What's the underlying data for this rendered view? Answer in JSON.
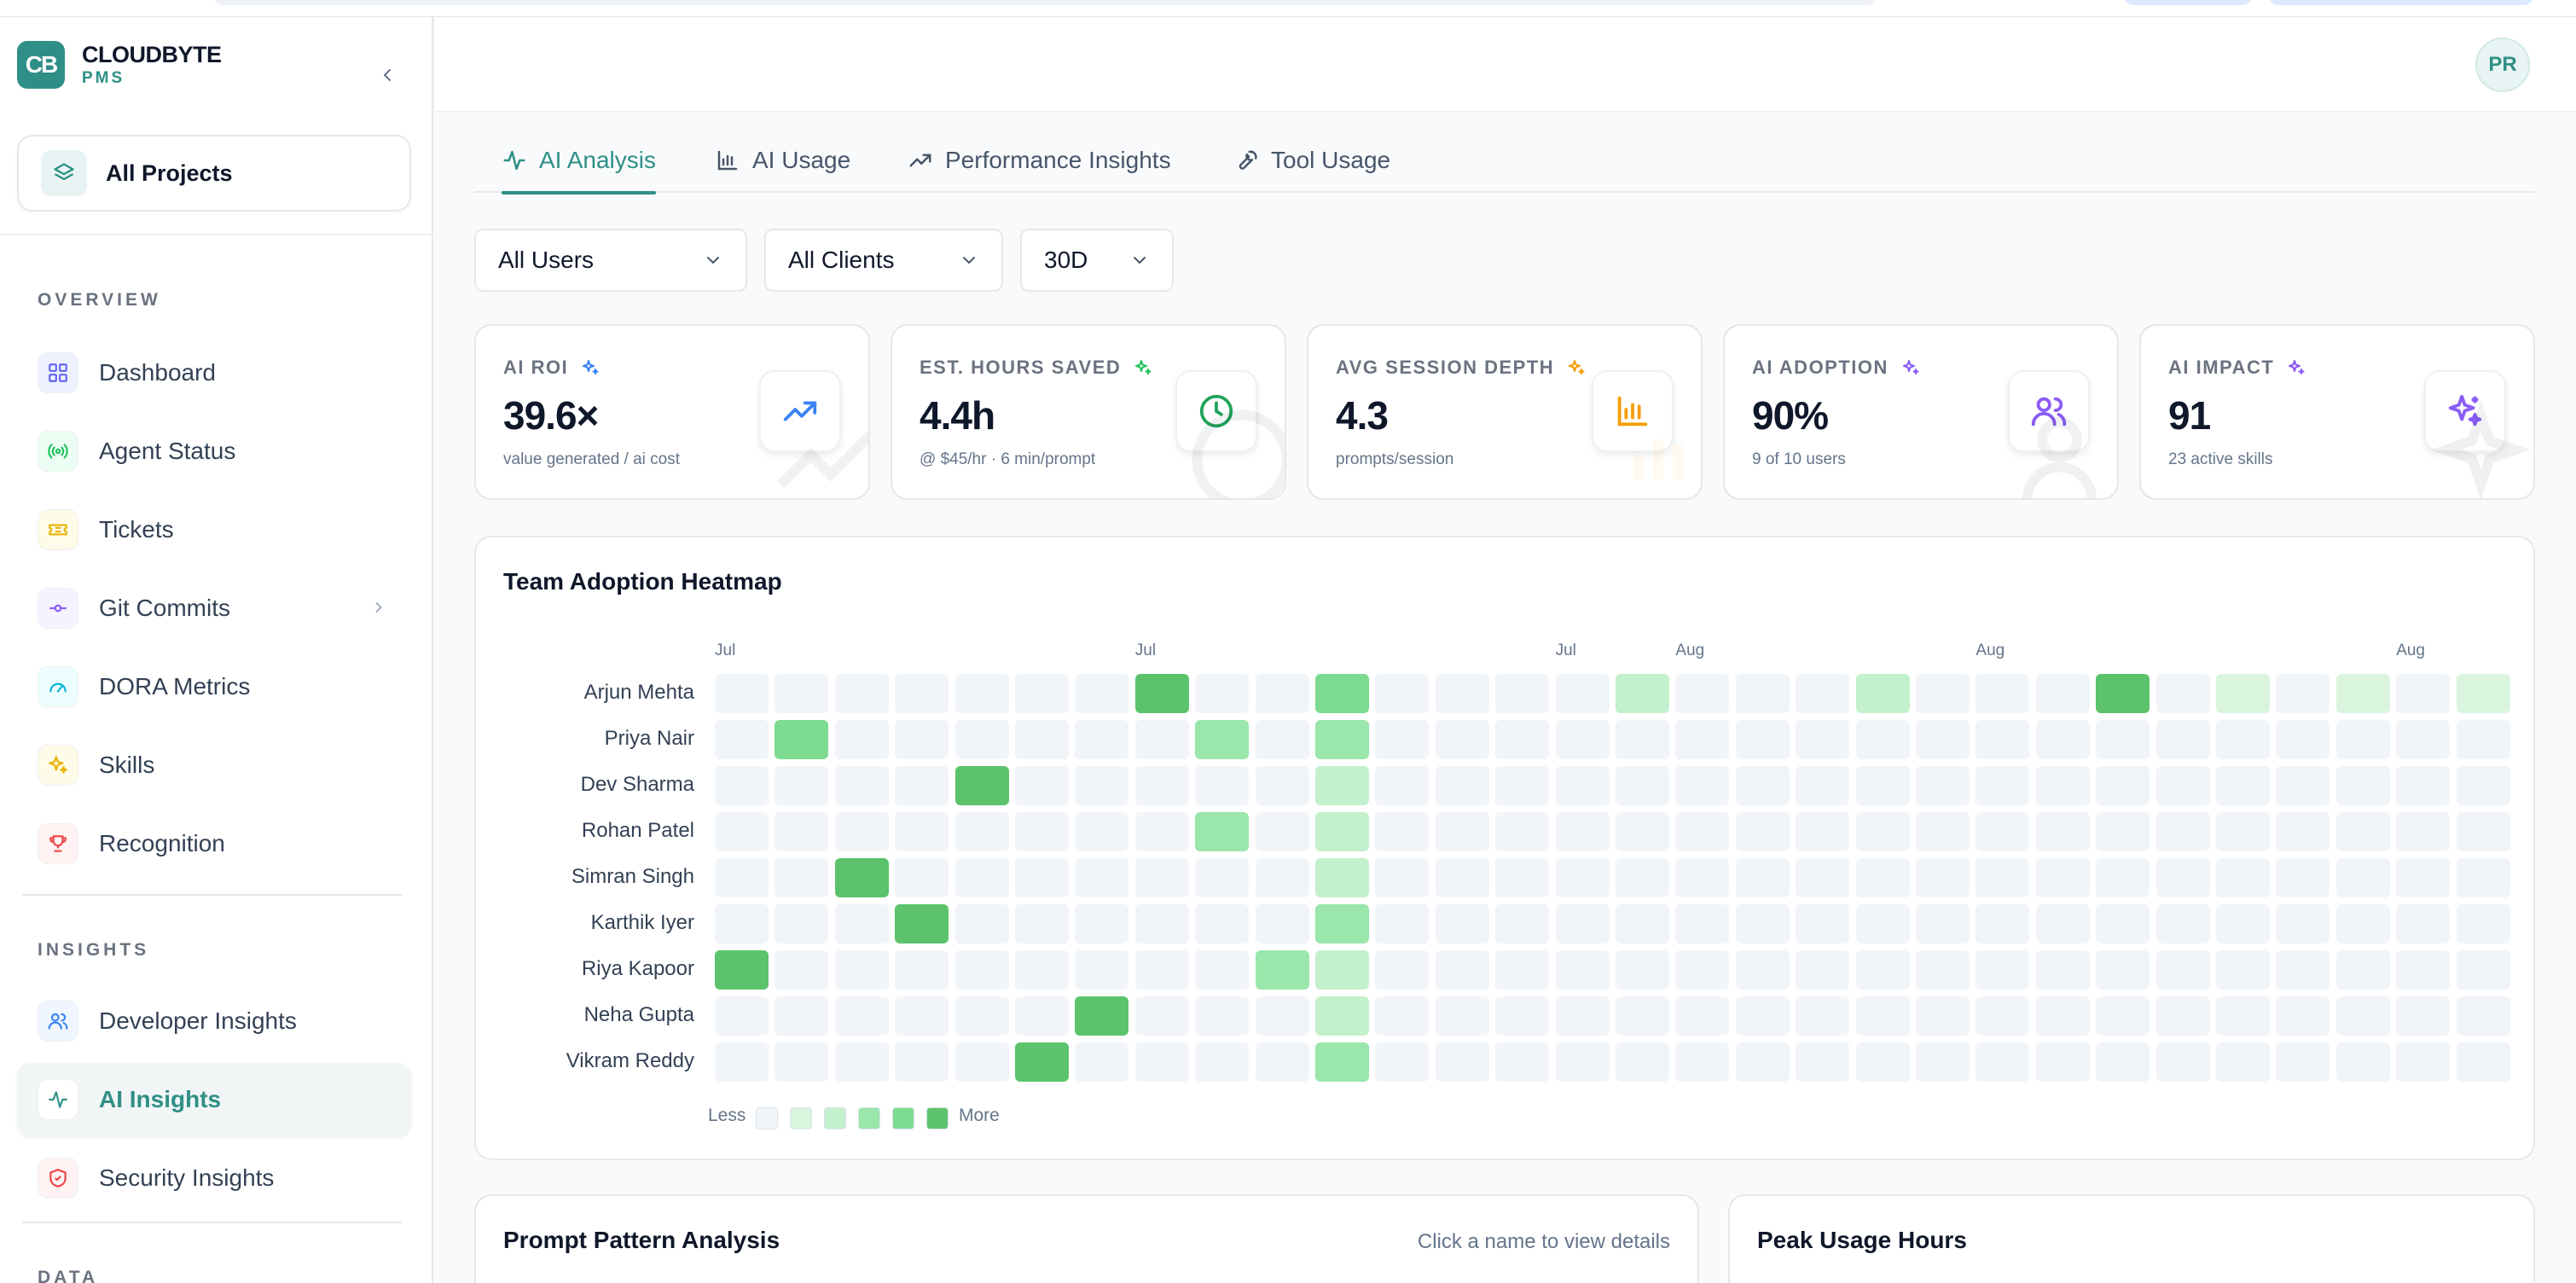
{
  "brand": {
    "name": "CLOUDBYTE",
    "sub": "PMS",
    "logo": "CB"
  },
  "project_switcher": {
    "label": "All Projects"
  },
  "sections": {
    "overview": "OVERVIEW",
    "insights": "INSIGHTS",
    "data": "DATA"
  },
  "nav": {
    "overview": [
      {
        "label": "Dashboard",
        "icon": "grid-icon",
        "color": "#6366f1"
      },
      {
        "label": "Agent Status",
        "icon": "broadcast-icon",
        "color": "#22c55e"
      },
      {
        "label": "Tickets",
        "icon": "ticket-icon",
        "color": "#eab308"
      },
      {
        "label": "Git Commits",
        "icon": "git-commit-icon",
        "color": "#8b5cf6"
      },
      {
        "label": "DORA Metrics",
        "icon": "gauge-icon",
        "color": "#06b6d4"
      },
      {
        "label": "Skills",
        "icon": "sparkle-icon",
        "color": "#eab308"
      },
      {
        "label": "Recognition",
        "icon": "trophy-icon",
        "color": "#ef4444"
      }
    ],
    "insights": [
      {
        "label": "Developer Insights",
        "icon": "users-icon",
        "color": "#3b82f6"
      },
      {
        "label": "AI Insights",
        "icon": "activity-icon",
        "color": "#2f8f86"
      },
      {
        "label": "Security Insights",
        "icon": "shield-icon",
        "color": "#ef4444"
      }
    ]
  },
  "user": {
    "initials": "PR"
  },
  "tabs": [
    {
      "label": "AI Analysis",
      "icon": "activity-icon"
    },
    {
      "label": "AI Usage",
      "icon": "bar-chart-icon"
    },
    {
      "label": "Performance Insights",
      "icon": "trending-up-icon"
    },
    {
      "label": "Tool Usage",
      "icon": "wrench-icon"
    }
  ],
  "filters": {
    "users": "All Users",
    "clients": "All Clients",
    "range": "30D"
  },
  "kpis": [
    {
      "label": "AI ROI",
      "value": "39.6×",
      "sub": "value generated / ai cost",
      "icon": "trending-up-icon",
      "accent": "#3b82f6"
    },
    {
      "label": "EST. HOURS SAVED",
      "value": "4.4h",
      "sub": "@ $45/hr · 6 min/prompt",
      "icon": "clock-icon",
      "accent": "#22c55e"
    },
    {
      "label": "AVG SESSION DEPTH",
      "value": "4.3",
      "sub": "prompts/session",
      "icon": "bar-chart-icon",
      "accent": "#f59e0b"
    },
    {
      "label": "AI ADOPTION",
      "value": "90%",
      "sub": "9 of 10 users",
      "icon": "users-icon",
      "accent": "#8b5cf6"
    },
    {
      "label": "AI IMPACT",
      "value": "91",
      "sub": "23 active skills",
      "icon": "sparkle-icon",
      "accent": "#8b5cf6"
    }
  ],
  "heatmap": {
    "title": "Team Adoption Heatmap",
    "months": [
      {
        "label": "Jul",
        "col": 0
      },
      {
        "label": "Jul",
        "col": 7
      },
      {
        "label": "Jul",
        "col": 14
      },
      {
        "label": "Aug",
        "col": 16
      },
      {
        "label": "Aug",
        "col": 21
      },
      {
        "label": "Aug",
        "col": 28
      }
    ],
    "columns": 30,
    "rows": [
      {
        "name": "Arjun Mehta",
        "levels": [
          0,
          0,
          0,
          0,
          0,
          0,
          0,
          5,
          0,
          0,
          4,
          0,
          0,
          0,
          0,
          2,
          0,
          0,
          0,
          2,
          0,
          0,
          0,
          5,
          0,
          1,
          0,
          1,
          0,
          1
        ]
      },
      {
        "name": "Priya Nair",
        "levels": [
          0,
          4,
          0,
          0,
          0,
          0,
          0,
          0,
          3,
          0,
          3,
          0,
          0,
          0,
          0,
          0,
          0,
          0,
          0,
          0,
          0,
          0,
          0,
          0,
          0,
          0,
          0,
          0,
          0,
          0
        ]
      },
      {
        "name": "Dev Sharma",
        "levels": [
          0,
          0,
          0,
          0,
          5,
          0,
          0,
          0,
          0,
          0,
          2,
          0,
          0,
          0,
          0,
          0,
          0,
          0,
          0,
          0,
          0,
          0,
          0,
          0,
          0,
          0,
          0,
          0,
          0,
          0
        ]
      },
      {
        "name": "Rohan Patel",
        "levels": [
          0,
          0,
          0,
          0,
          0,
          0,
          0,
          0,
          3,
          0,
          2,
          0,
          0,
          0,
          0,
          0,
          0,
          0,
          0,
          0,
          0,
          0,
          0,
          0,
          0,
          0,
          0,
          0,
          0,
          0
        ]
      },
      {
        "name": "Simran Singh",
        "levels": [
          0,
          0,
          5,
          0,
          0,
          0,
          0,
          0,
          0,
          0,
          2,
          0,
          0,
          0,
          0,
          0,
          0,
          0,
          0,
          0,
          0,
          0,
          0,
          0,
          0,
          0,
          0,
          0,
          0,
          0
        ]
      },
      {
        "name": "Karthik Iyer",
        "levels": [
          0,
          0,
          0,
          5,
          0,
          0,
          0,
          0,
          0,
          0,
          3,
          0,
          0,
          0,
          0,
          0,
          0,
          0,
          0,
          0,
          0,
          0,
          0,
          0,
          0,
          0,
          0,
          0,
          0,
          0
        ]
      },
      {
        "name": "Riya Kapoor",
        "levels": [
          5,
          0,
          0,
          0,
          0,
          0,
          0,
          0,
          0,
          3,
          2,
          0,
          0,
          0,
          0,
          0,
          0,
          0,
          0,
          0,
          0,
          0,
          0,
          0,
          0,
          0,
          0,
          0,
          0,
          0
        ]
      },
      {
        "name": "Neha Gupta",
        "levels": [
          0,
          0,
          0,
          0,
          0,
          0,
          5,
          0,
          0,
          0,
          2,
          0,
          0,
          0,
          0,
          0,
          0,
          0,
          0,
          0,
          0,
          0,
          0,
          0,
          0,
          0,
          0,
          0,
          0,
          0
        ]
      },
      {
        "name": "Vikram Reddy",
        "levels": [
          0,
          0,
          0,
          0,
          0,
          5,
          0,
          0,
          0,
          0,
          3,
          0,
          0,
          0,
          0,
          0,
          0,
          0,
          0,
          0,
          0,
          0,
          0,
          0,
          0,
          0,
          0,
          0,
          0,
          0
        ]
      }
    ],
    "legend": {
      "less": "Less",
      "more": "More"
    },
    "level_colors": [
      "#f1f5f9",
      "#d9f5de",
      "#c3f0cd",
      "#9ae6ab",
      "#7ddb8f",
      "#5cc36c"
    ]
  },
  "prompt_pattern": {
    "title": "Prompt Pattern Analysis",
    "hint": "Click a name to view details"
  },
  "peak_usage": {
    "title": "Peak Usage Hours"
  }
}
